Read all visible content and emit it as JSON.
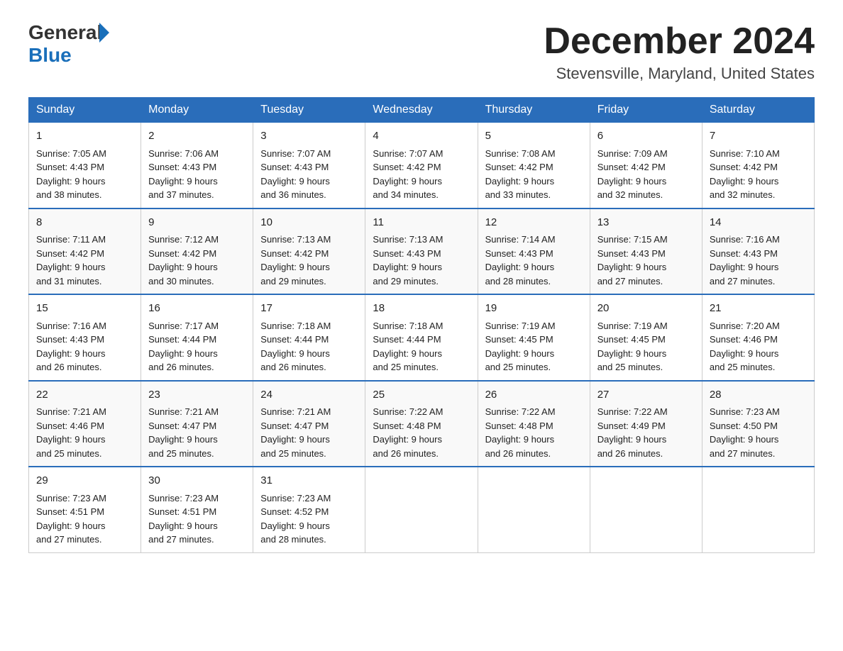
{
  "header": {
    "logo_general": "General",
    "logo_blue": "Blue",
    "month_title": "December 2024",
    "location": "Stevensville, Maryland, United States"
  },
  "days_of_week": [
    "Sunday",
    "Monday",
    "Tuesday",
    "Wednesday",
    "Thursday",
    "Friday",
    "Saturday"
  ],
  "weeks": [
    [
      {
        "day": "1",
        "sunrise": "7:05 AM",
        "sunset": "4:43 PM",
        "daylight": "9 hours and 38 minutes."
      },
      {
        "day": "2",
        "sunrise": "7:06 AM",
        "sunset": "4:43 PM",
        "daylight": "9 hours and 37 minutes."
      },
      {
        "day": "3",
        "sunrise": "7:07 AM",
        "sunset": "4:43 PM",
        "daylight": "9 hours and 36 minutes."
      },
      {
        "day": "4",
        "sunrise": "7:07 AM",
        "sunset": "4:42 PM",
        "daylight": "9 hours and 34 minutes."
      },
      {
        "day": "5",
        "sunrise": "7:08 AM",
        "sunset": "4:42 PM",
        "daylight": "9 hours and 33 minutes."
      },
      {
        "day": "6",
        "sunrise": "7:09 AM",
        "sunset": "4:42 PM",
        "daylight": "9 hours and 32 minutes."
      },
      {
        "day": "7",
        "sunrise": "7:10 AM",
        "sunset": "4:42 PM",
        "daylight": "9 hours and 32 minutes."
      }
    ],
    [
      {
        "day": "8",
        "sunrise": "7:11 AM",
        "sunset": "4:42 PM",
        "daylight": "9 hours and 31 minutes."
      },
      {
        "day": "9",
        "sunrise": "7:12 AM",
        "sunset": "4:42 PM",
        "daylight": "9 hours and 30 minutes."
      },
      {
        "day": "10",
        "sunrise": "7:13 AM",
        "sunset": "4:42 PM",
        "daylight": "9 hours and 29 minutes."
      },
      {
        "day": "11",
        "sunrise": "7:13 AM",
        "sunset": "4:43 PM",
        "daylight": "9 hours and 29 minutes."
      },
      {
        "day": "12",
        "sunrise": "7:14 AM",
        "sunset": "4:43 PM",
        "daylight": "9 hours and 28 minutes."
      },
      {
        "day": "13",
        "sunrise": "7:15 AM",
        "sunset": "4:43 PM",
        "daylight": "9 hours and 27 minutes."
      },
      {
        "day": "14",
        "sunrise": "7:16 AM",
        "sunset": "4:43 PM",
        "daylight": "9 hours and 27 minutes."
      }
    ],
    [
      {
        "day": "15",
        "sunrise": "7:16 AM",
        "sunset": "4:43 PM",
        "daylight": "9 hours and 26 minutes."
      },
      {
        "day": "16",
        "sunrise": "7:17 AM",
        "sunset": "4:44 PM",
        "daylight": "9 hours and 26 minutes."
      },
      {
        "day": "17",
        "sunrise": "7:18 AM",
        "sunset": "4:44 PM",
        "daylight": "9 hours and 26 minutes."
      },
      {
        "day": "18",
        "sunrise": "7:18 AM",
        "sunset": "4:44 PM",
        "daylight": "9 hours and 25 minutes."
      },
      {
        "day": "19",
        "sunrise": "7:19 AM",
        "sunset": "4:45 PM",
        "daylight": "9 hours and 25 minutes."
      },
      {
        "day": "20",
        "sunrise": "7:19 AM",
        "sunset": "4:45 PM",
        "daylight": "9 hours and 25 minutes."
      },
      {
        "day": "21",
        "sunrise": "7:20 AM",
        "sunset": "4:46 PM",
        "daylight": "9 hours and 25 minutes."
      }
    ],
    [
      {
        "day": "22",
        "sunrise": "7:21 AM",
        "sunset": "4:46 PM",
        "daylight": "9 hours and 25 minutes."
      },
      {
        "day": "23",
        "sunrise": "7:21 AM",
        "sunset": "4:47 PM",
        "daylight": "9 hours and 25 minutes."
      },
      {
        "day": "24",
        "sunrise": "7:21 AM",
        "sunset": "4:47 PM",
        "daylight": "9 hours and 25 minutes."
      },
      {
        "day": "25",
        "sunrise": "7:22 AM",
        "sunset": "4:48 PM",
        "daylight": "9 hours and 26 minutes."
      },
      {
        "day": "26",
        "sunrise": "7:22 AM",
        "sunset": "4:48 PM",
        "daylight": "9 hours and 26 minutes."
      },
      {
        "day": "27",
        "sunrise": "7:22 AM",
        "sunset": "4:49 PM",
        "daylight": "9 hours and 26 minutes."
      },
      {
        "day": "28",
        "sunrise": "7:23 AM",
        "sunset": "4:50 PM",
        "daylight": "9 hours and 27 minutes."
      }
    ],
    [
      {
        "day": "29",
        "sunrise": "7:23 AM",
        "sunset": "4:51 PM",
        "daylight": "9 hours and 27 minutes."
      },
      {
        "day": "30",
        "sunrise": "7:23 AM",
        "sunset": "4:51 PM",
        "daylight": "9 hours and 27 minutes."
      },
      {
        "day": "31",
        "sunrise": "7:23 AM",
        "sunset": "4:52 PM",
        "daylight": "9 hours and 28 minutes."
      },
      null,
      null,
      null,
      null
    ]
  ],
  "labels": {
    "sunrise": "Sunrise:",
    "sunset": "Sunset:",
    "daylight": "Daylight:"
  }
}
